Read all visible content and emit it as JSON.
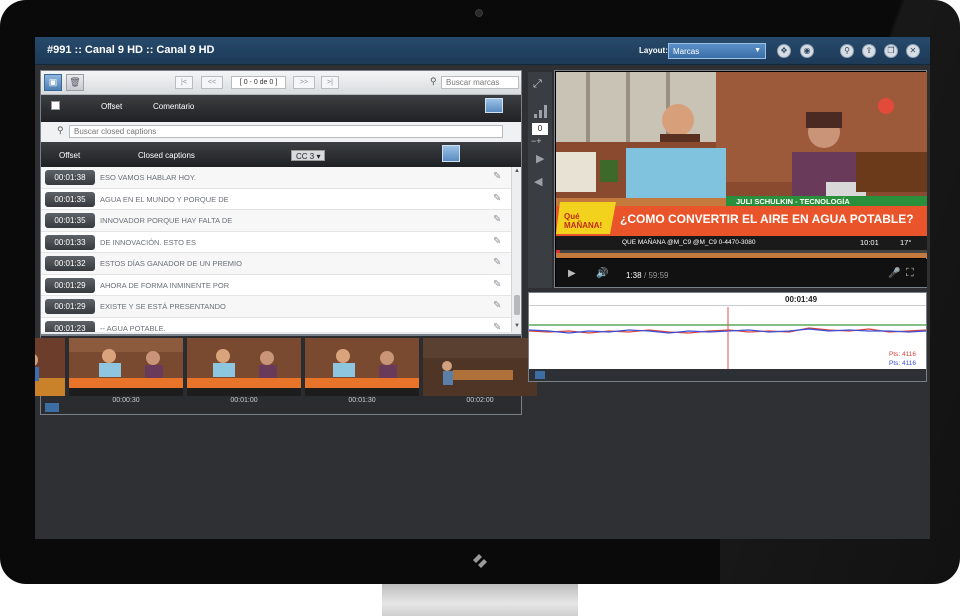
{
  "header": {
    "title": "#991 :: Canal 9 HD :: Canal 9 HD",
    "layout_label": "Layout:",
    "layout_value": "Marcas"
  },
  "markers": {
    "pager": "[ 0 - 0 de 0 ]",
    "nav": {
      "first": "|<",
      "prev": "<<",
      "next": ">>",
      "last": ">|"
    },
    "search_placeholder": "Buscar marcas",
    "col_offset": "Offset",
    "col_comment": "Comentario"
  },
  "captions": {
    "search_placeholder": "Buscar closed captions",
    "col_offset": "Offset",
    "col_captions": "Closed captions",
    "cc_select": "CC 3",
    "rows": [
      {
        "time": "00:01:38",
        "text": "ESO VAMOS HABLAR HOY."
      },
      {
        "time": "00:01:35",
        "text": "AGUA EN EL MUNDO Y PORQUE DE"
      },
      {
        "time": "00:01:35",
        "text": "INNOVADOR PORQUE HAY FALTA DE"
      },
      {
        "time": "00:01:33",
        "text": "DE INNOVACIÓN. ESTO ES"
      },
      {
        "time": "00:01:32",
        "text": "ESTOS DÍAS GANADOR DE UN PREMIO"
      },
      {
        "time": "00:01:29",
        "text": "AHORA DE FORMA INMINENTE POR"
      },
      {
        "time": "00:01:29",
        "text": "EXISTE Y SE ESTÁ PRESENTANDO"
      },
      {
        "time": "00:01:23",
        "text": "-- AGUA POTABLE."
      }
    ]
  },
  "thumbnails": [
    "00:00:30",
    "00:01:00",
    "00:01:30",
    "00:02:00"
  ],
  "video": {
    "time": "1:38",
    "duration": "/ 59:59",
    "lower_third_name": "JULI SCHULKIN - TECNOLOGÍA",
    "headline": "¿COMO CONVERTIR EL AIRE EN AGUA POTABLE?",
    "show_logo": "Qué MAÑANA!",
    "ticker": "QUE MAÑANA  @M_C9  @M_C9  0-4470-3080",
    "clock": "10:01",
    "temp": "17°",
    "zoom_value": "0"
  },
  "graph": {
    "time": "00:01:49",
    "legend": [
      "Pts: 4116",
      "Pts: 4116"
    ],
    "colors": {
      "line1": "#d9433b",
      "line2": "#3b4fd9",
      "baseline": "#3a9a3a",
      "cursor": "#e05050"
    }
  }
}
